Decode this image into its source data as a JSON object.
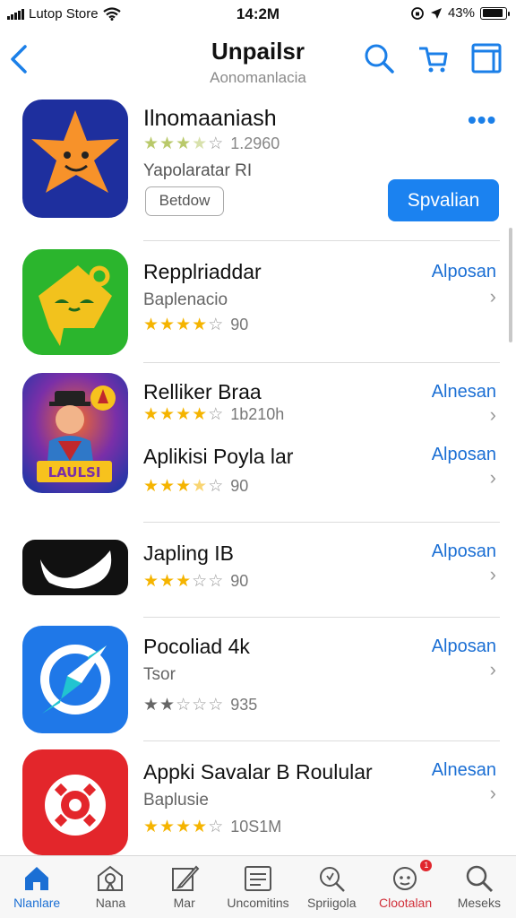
{
  "status_bar": {
    "carrier": "Lutop Store",
    "time": "14:2M",
    "battery": "43%",
    "battery_level": 0.88
  },
  "nav": {
    "title": "Unpailsr",
    "subtitle": "Aonomanlacia",
    "icons": [
      "back-chevron-icon",
      "search-icon",
      "share-icon",
      "window-icon"
    ]
  },
  "featured": {
    "name": "Ilnomaaniash",
    "rating_stars": 3.5,
    "rating_count": "1.2960",
    "subtitle": "Yapolaratar RI",
    "outline_button": "Betdow",
    "primary_button": "Spvalian",
    "more": "•••",
    "icon_colors": [
      "#1e2f9e",
      "#f7922a"
    ]
  },
  "apps": [
    {
      "name": "Repplriaddar",
      "subtitle": "Baplenacio",
      "rating_stars": 4,
      "rating_text": "90",
      "action": "Alposan",
      "icon": "green-chat-icon"
    },
    {
      "name": "Relliker Braa",
      "subtitle": "",
      "rating_stars": 4,
      "rating_text": "1b210h",
      "action": "Alnesan",
      "icon": "character-icon"
    },
    {
      "name": "Aplikisi Poyla lar",
      "subtitle": "",
      "rating_stars": 3.5,
      "rating_text": "90",
      "action": "Alposan",
      "icon": "character-icon"
    },
    {
      "name": "Japling IB",
      "subtitle": "",
      "rating_stars": 3,
      "rating_text": "90",
      "action": "Alposan",
      "icon": "black-wave-icon"
    },
    {
      "name": "Pocoliad 4k",
      "subtitle": "Tsor",
      "rating_stars": 2,
      "rating_text": "935",
      "action": "Alposan",
      "icon": "blue-compass-icon"
    },
    {
      "name": "Appki Savalar B Roulular",
      "subtitle": "Baplusie",
      "rating_stars": 4,
      "rating_text": "10S1M",
      "action": "Alnesan",
      "icon": "red-ring-icon"
    }
  ],
  "tabs": [
    {
      "label": "Nlanlare",
      "icon": "home-icon",
      "state": "active"
    },
    {
      "label": "Nana",
      "icon": "location-icon",
      "state": "normal"
    },
    {
      "label": "Mar",
      "icon": "pen-icon",
      "state": "normal"
    },
    {
      "label": "Uncomitins",
      "icon": "list-icon",
      "state": "normal"
    },
    {
      "label": "Spriigola",
      "icon": "search-icon",
      "state": "normal"
    },
    {
      "label": "Clootalan",
      "icon": "notification-icon",
      "state": "alert",
      "badge": "1"
    },
    {
      "label": "Meseks",
      "icon": "search-icon",
      "state": "normal"
    }
  ],
  "colors": {
    "accent": "#1b82f0",
    "link": "#1b6fd4",
    "star": "#f5b400",
    "star_featured": "#b9c96a",
    "alert": "#d1303a"
  }
}
